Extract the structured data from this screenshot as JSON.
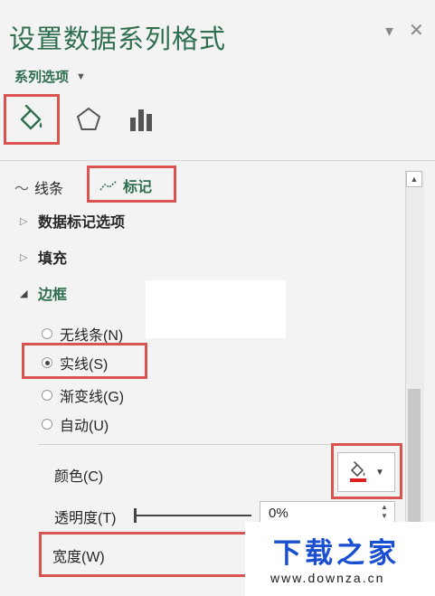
{
  "panel": {
    "title": "设置数据系列格式",
    "options_dropdown": "系列选项"
  },
  "tabs": [
    {
      "icon": "paint-bucket-icon",
      "active": true
    },
    {
      "icon": "pentagon-icon"
    },
    {
      "icon": "bar-chart-icon"
    }
  ],
  "subtabs": {
    "line": "线条",
    "marker": "标记"
  },
  "sections": {
    "marker_options": "数据标记选项",
    "fill": "填充",
    "border": "边框"
  },
  "border_options": [
    {
      "label": "无线条(N)",
      "selected": false
    },
    {
      "label": "实线(S)",
      "selected": true
    },
    {
      "label": "渐变线(G)",
      "selected": false
    },
    {
      "label": "自动(U)",
      "selected": false
    }
  ],
  "properties": {
    "color_label": "颜色(C)",
    "transparency_label": "透明度(T)",
    "transparency_value": "0%",
    "width_label": "宽度(W)"
  },
  "watermark": {
    "title": "下载之家",
    "url": "www.downza.cn"
  },
  "colors": {
    "accent_green": "#2f6f4f",
    "highlight_red": "#d9534f",
    "swatch_red": "#e02020"
  }
}
